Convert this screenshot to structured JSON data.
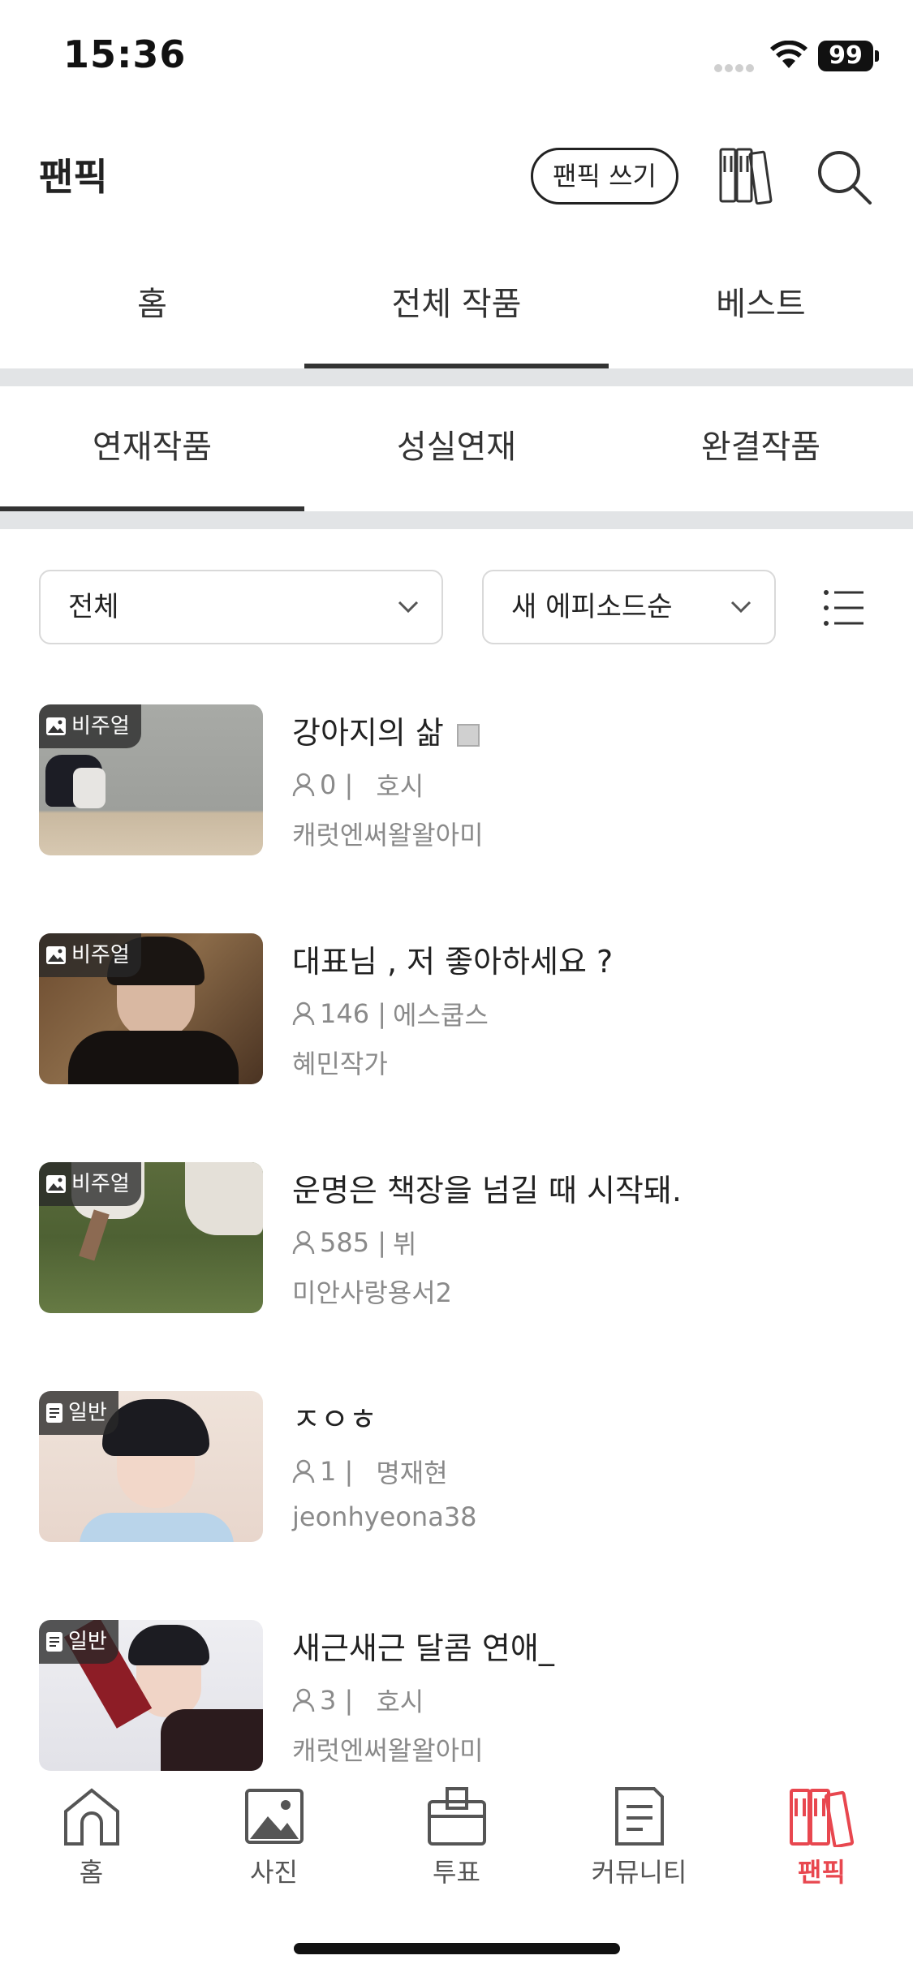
{
  "status_bar": {
    "time": "15:36",
    "battery": "99"
  },
  "header": {
    "title": "팬픽",
    "write_label": "팬픽 쓰기"
  },
  "top_tabs": [
    {
      "label": "홈"
    },
    {
      "label": "전체 작품",
      "active": true
    },
    {
      "label": "베스트"
    }
  ],
  "sub_tabs": [
    {
      "label": "연재작품",
      "active": true
    },
    {
      "label": "성실연재"
    },
    {
      "label": "완결작품"
    }
  ],
  "filters": {
    "category": "전체",
    "sort": "새 에피소드순"
  },
  "works": [
    {
      "badge": "비주얼",
      "badge_icon": "image-icon",
      "title": "강아지의 삶",
      "readers": "0 |",
      "genre": "호시",
      "author": "캐럿엔써왈왈아미"
    },
    {
      "badge": "비주얼",
      "badge_icon": "image-icon",
      "title": "대표님 ,  저 좋아하세요 ?",
      "readers": "146 |",
      "genre": "에스쿱스",
      "author": "혜민작가"
    },
    {
      "badge": "비주얼",
      "badge_icon": "image-icon",
      "title": "운명은 책장을 넘길 때 시작돼.",
      "readers": "585 |",
      "genre": "뷔",
      "author": "미안사랑용서2"
    },
    {
      "badge": "일반",
      "badge_icon": "document-icon",
      "title": "ㅈㅇㅎ",
      "readers": "1 |",
      "genre": "명재현",
      "author": "jeonhyeona38"
    },
    {
      "badge": "일반",
      "badge_icon": "document-icon",
      "title": "새근새근 달콤 연애_",
      "readers": "3 |",
      "genre": "호시",
      "author": "캐럿엔써왈왈아미"
    }
  ],
  "bottom_nav": [
    {
      "label": "홈",
      "icon": "home-icon"
    },
    {
      "label": "사진",
      "icon": "photo-icon"
    },
    {
      "label": "투표",
      "icon": "vote-icon"
    },
    {
      "label": "커뮤니티",
      "icon": "community-icon"
    },
    {
      "label": "팬픽",
      "icon": "fanfic-icon",
      "active": true
    }
  ],
  "colors": {
    "accent": "#e8474f",
    "tab_band": "#e2e4e6",
    "meta_text": "#8a8a8a"
  }
}
